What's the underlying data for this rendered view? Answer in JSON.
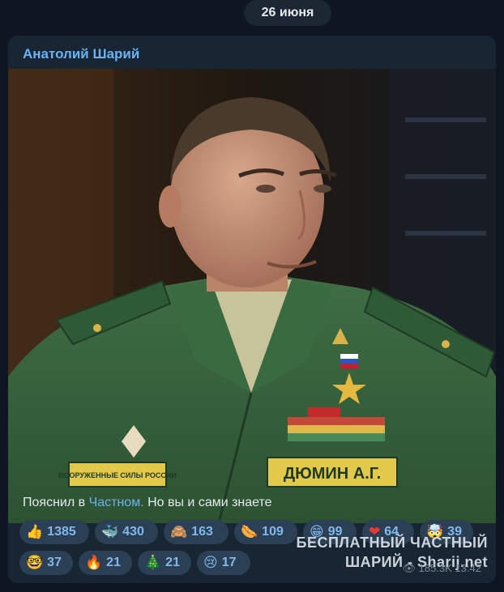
{
  "date_label": "26 июня",
  "post": {
    "author": "Анатолий Шарий",
    "caption_before": "Пояснил в ",
    "caption_link": "Частном.",
    "caption_after": " Но вы и сами знаете",
    "views": "185.3K",
    "time": "13:42",
    "photo": {
      "badge_text": "ДЮМИН А.Г.",
      "patch_text": "ВООРУЖЕННЫЕ СИЛЫ РОССИИ"
    }
  },
  "reactions": [
    {
      "emoji": "👍",
      "count": "1385"
    },
    {
      "emoji": "🐳",
      "count": "430"
    },
    {
      "emoji": "🙈",
      "count": "163"
    },
    {
      "emoji": "🌭",
      "count": "109"
    },
    {
      "emoji": "😁",
      "count": "99"
    },
    {
      "emoji": "❤",
      "count": "64"
    },
    {
      "emoji": "🤯",
      "count": "39"
    },
    {
      "emoji": "🤓",
      "count": "37"
    },
    {
      "emoji": "🔥",
      "count": "21"
    },
    {
      "emoji": "🎄",
      "count": "21"
    },
    {
      "emoji": "😢",
      "count": "17"
    }
  ],
  "watermark": {
    "line1": "БЕСПЛАТНЫЙ ЧАСТНЫЙ",
    "line2": "ШАРИЙ - Sharij.net"
  },
  "colors": {
    "background": "#0e1621",
    "bubble": "#182533",
    "accent": "#6ab2f2",
    "reaction_bg": "#2b3f55"
  }
}
